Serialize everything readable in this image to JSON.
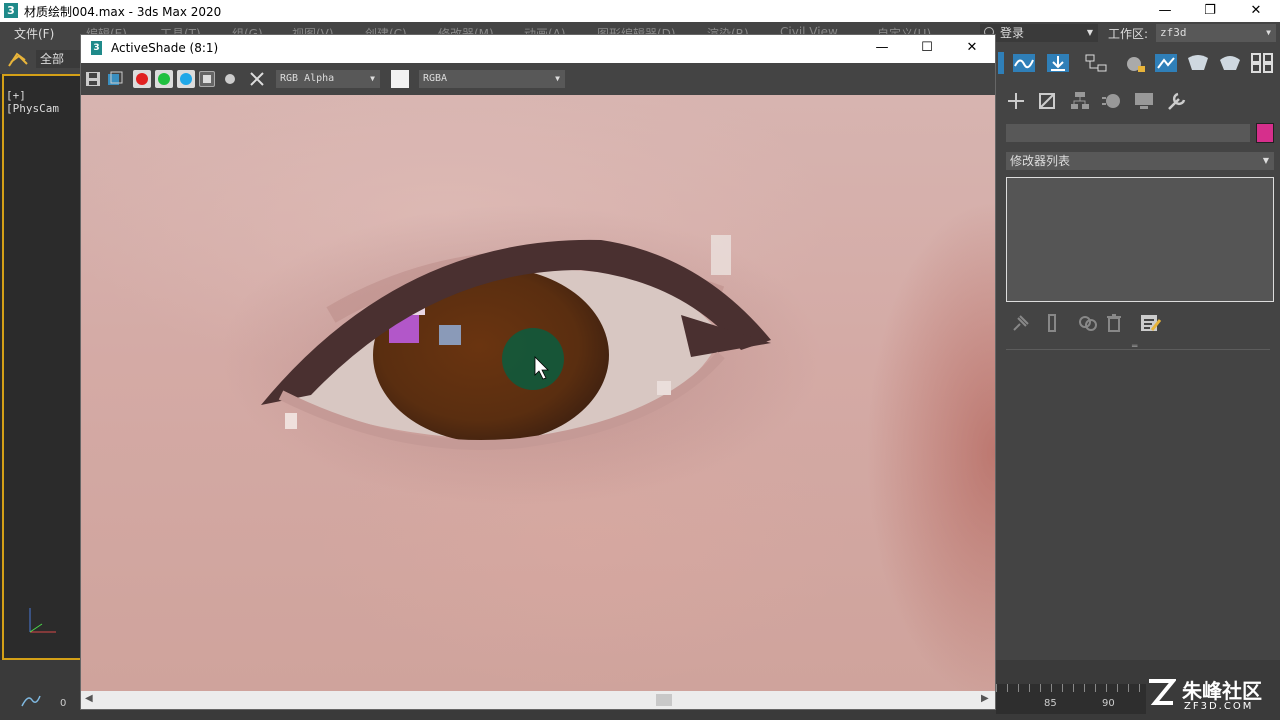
{
  "app": {
    "title": "材质绘制004.max - 3ds Max 2020",
    "icon_glyph": "3",
    "window_controls": [
      "—",
      "❐",
      "✕"
    ]
  },
  "menubar": {
    "items": [
      "文件(F)",
      "编辑(E)",
      "工具(T)",
      "组(G)",
      "视图(V)",
      "创建(C)",
      "修改器(M)",
      "动画(A)",
      "图形编辑器(D)",
      "渲染(R)",
      "Civil View",
      "自定义(U)"
    ],
    "login_label": "登录",
    "workspace_label": "工作区:",
    "workspace_value": "zf3d"
  },
  "left_toolbar": {
    "selection_filter": "全部"
  },
  "left_viewport": {
    "label": "[+] [PhysCam"
  },
  "activeshade": {
    "title": "ActiveShade (8:1)",
    "icon_glyph": "3",
    "window_controls": [
      "—",
      "☐",
      "✕"
    ],
    "channel_display": "RGB Alpha",
    "color_mode": "RGBA"
  },
  "command_panel": {
    "modifier_list_label": "修改器列表",
    "object_color": "#d62f8c",
    "separator_glyph": "═"
  },
  "timeline": {
    "start_frame": "0",
    "ticks": [
      "85",
      "90"
    ]
  },
  "watermark": {
    "brand": "朱峰社区",
    "url": "ZF3D.COM"
  },
  "colors": {
    "accent_teal": "#1f8a8a",
    "viewport_border": "#d4a017",
    "brush_cursor": "#0f5a3c"
  }
}
